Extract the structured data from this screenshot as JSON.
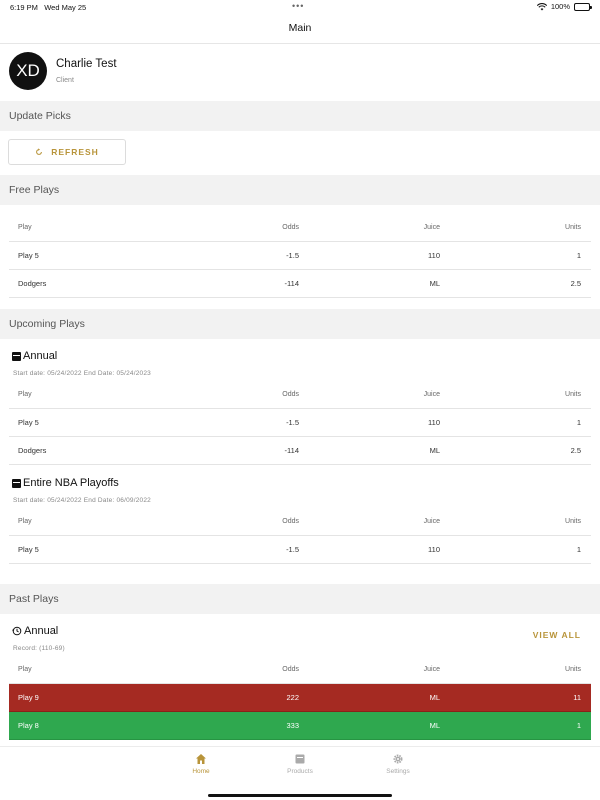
{
  "status_bar": {
    "time": "6:19 PM",
    "date": "Wed May 25",
    "battery": "100%"
  },
  "nav": {
    "title": "Main"
  },
  "profile": {
    "initials": "XD",
    "name": "Charlie Test",
    "role": "Client"
  },
  "sections": {
    "update_picks": "Update Picks",
    "free_plays": "Free Plays",
    "upcoming_plays": "Upcoming Plays",
    "past_plays": "Past Plays"
  },
  "refresh_label": "REFRESH",
  "columns": {
    "play": "Play",
    "odds": "Odds",
    "juice": "Juice",
    "units": "Units"
  },
  "free_plays": [
    {
      "play": "Play 5",
      "odds": "-1.5",
      "juice": "110",
      "units": "1"
    },
    {
      "play": "Dodgers",
      "odds": "-114",
      "juice": "ML",
      "units": "2.5"
    }
  ],
  "upcoming": [
    {
      "title": "Annual",
      "subtitle": "Start date: 05/24/2022 End Date: 05/24/2023",
      "rows": [
        {
          "play": "Play 5",
          "odds": "-1.5",
          "juice": "110",
          "units": "1"
        },
        {
          "play": "Dodgers",
          "odds": "-114",
          "juice": "ML",
          "units": "2.5"
        }
      ]
    },
    {
      "title": "Entire NBA Playoffs",
      "subtitle": "Start date: 05/24/2022 End Date: 06/09/2022",
      "rows": [
        {
          "play": "Play 5",
          "odds": "-1.5",
          "juice": "110",
          "units": "1"
        }
      ]
    }
  ],
  "past": {
    "title": "Annual",
    "record": "Record: (110-69)",
    "view_all": "VIEW ALL",
    "rows": [
      {
        "play": "Play 9",
        "odds": "222",
        "juice": "ML",
        "units": "11",
        "result": "loss"
      },
      {
        "play": "Play 8",
        "odds": "333",
        "juice": "ML",
        "units": "1",
        "result": "win"
      }
    ]
  },
  "tabs": [
    {
      "label": "Home",
      "icon": "home-icon"
    },
    {
      "label": "Products",
      "icon": "products-icon"
    },
    {
      "label": "Settings",
      "icon": "gear-icon"
    }
  ],
  "colors": {
    "accent": "#b8943a",
    "loss": "#a52a22",
    "win": "#2fa84f",
    "section_bg": "#f2f2f2"
  }
}
